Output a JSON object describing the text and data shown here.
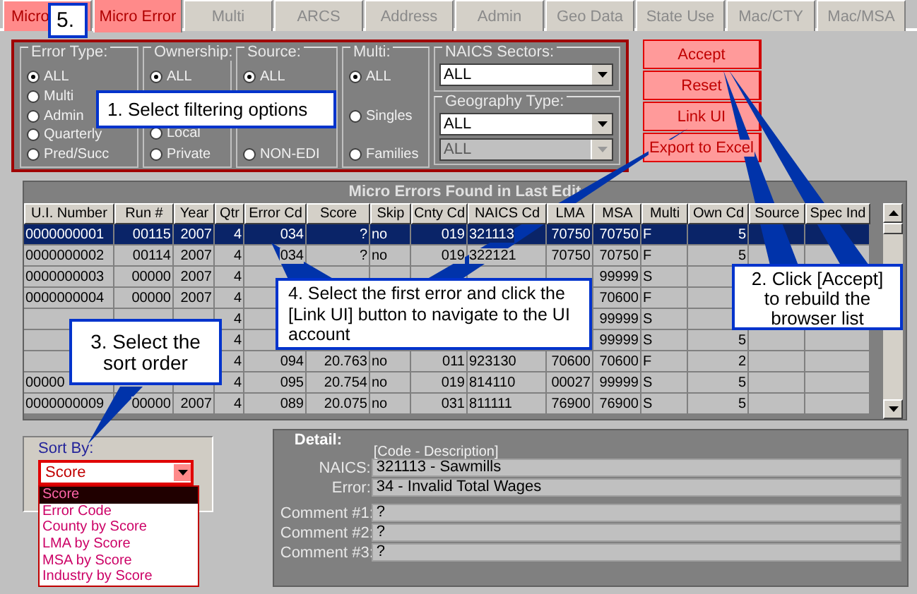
{
  "tabs": [
    {
      "label": "Micro",
      "selected": false,
      "disabled": false
    },
    {
      "label": "Micro Error",
      "selected": true,
      "disabled": false
    },
    {
      "label": "Multi",
      "selected": false,
      "disabled": true
    },
    {
      "label": "ARCS",
      "selected": false,
      "disabled": true
    },
    {
      "label": "Address",
      "selected": false,
      "disabled": true
    },
    {
      "label": "Admin",
      "selected": false,
      "disabled": true
    },
    {
      "label": "Geo Data",
      "selected": false,
      "disabled": true
    },
    {
      "label": "State Use",
      "selected": false,
      "disabled": true
    },
    {
      "label": "Mac/CTY",
      "selected": false,
      "disabled": true
    },
    {
      "label": "Mac/MSA",
      "selected": false,
      "disabled": true
    }
  ],
  "filters": {
    "groups": [
      {
        "title": "Error Type:",
        "options": [
          {
            "label": "ALL",
            "selected": true
          },
          {
            "label": "Multi",
            "selected": false
          },
          {
            "label": "Admin",
            "selected": false
          },
          {
            "label": "Quarterly",
            "selected": false
          },
          {
            "label": "Pred/Succ",
            "selected": false
          }
        ]
      },
      {
        "title": "Ownership:",
        "options": [
          {
            "label": "ALL",
            "selected": true
          },
          {
            "label": "Local",
            "selected": false
          },
          {
            "label": "Private",
            "selected": false
          }
        ]
      },
      {
        "title": "Source:",
        "options": [
          {
            "label": "ALL",
            "selected": true
          },
          {
            "label": "NON-EDI",
            "selected": false
          }
        ]
      },
      {
        "title": "Multi:",
        "options": [
          {
            "label": "ALL",
            "selected": true
          },
          {
            "label": "Singles",
            "selected": false
          },
          {
            "label": "Families",
            "selected": false
          }
        ]
      }
    ],
    "naics_sectors": {
      "label": "NAICS Sectors:",
      "value": "ALL",
      "disabled": false
    },
    "geography_type": {
      "label": "Geography Type:",
      "value": "ALL",
      "disabled": false
    },
    "geography_combo_2": {
      "value": "ALL",
      "disabled": true
    }
  },
  "buttons": [
    "Accept",
    "Reset",
    "Link UI",
    "Export to Excel"
  ],
  "table": {
    "title": "Micro Errors Found in Last Edit",
    "columns": [
      "U.I. Number",
      "Run #",
      "Year",
      "Qtr",
      "Error Cd",
      "Score",
      "Skip",
      "Cnty Cd",
      "NAICS Cd",
      "LMA",
      "MSA",
      "Multi",
      "Own Cd",
      "Source",
      "Spec Ind"
    ],
    "rows": [
      {
        "selected": true,
        "cells": [
          "0000000001",
          "00115",
          "2007",
          "4",
          "034",
          "?",
          "no",
          "019",
          "321113",
          "70750",
          "70750",
          "F",
          "5",
          null,
          null
        ]
      },
      {
        "selected": false,
        "cells": [
          "0000000002",
          "00114",
          "2007",
          "4",
          "034",
          "?",
          "no",
          "019",
          "322121",
          "70750",
          "70750",
          "F",
          "5",
          null,
          null
        ]
      },
      {
        "selected": false,
        "cells": [
          "0000000003",
          "00000",
          "2007",
          "4",
          null,
          null,
          null,
          null,
          null,
          null,
          "99999",
          "S",
          null,
          null,
          null
        ]
      },
      {
        "selected": false,
        "cells": [
          "0000000004",
          "00000",
          "2007",
          "4",
          null,
          null,
          null,
          null,
          null,
          null,
          "70600",
          "F",
          null,
          null,
          null
        ]
      },
      {
        "selected": false,
        "cells": [
          null,
          null,
          null,
          "4",
          null,
          null,
          null,
          null,
          null,
          null,
          "99999",
          "S",
          null,
          null,
          null
        ]
      },
      {
        "selected": false,
        "cells": [
          null,
          null,
          null,
          "4",
          null,
          null,
          null,
          null,
          null,
          null,
          "99999",
          "S",
          "5",
          null,
          null
        ]
      },
      {
        "selected": false,
        "cells": [
          null,
          null,
          null,
          "4",
          "094",
          "20.763",
          "no",
          "011",
          "923130",
          "70600",
          "70600",
          "F",
          "2",
          null,
          null
        ]
      },
      {
        "selected": false,
        "cells": [
          "00000",
          null,
          null,
          "4",
          "095",
          "20.754",
          "no",
          "019",
          "814110",
          "00027",
          "99999",
          "S",
          "5",
          null,
          null
        ]
      },
      {
        "selected": false,
        "cells": [
          "0000000009",
          "00000",
          "2007",
          "4",
          "089",
          "20.075",
          "no",
          "031",
          "811111",
          "76900",
          "76900",
          "S",
          "5",
          null,
          null
        ]
      }
    ]
  },
  "sort": {
    "label": "Sort By:",
    "value": "Score",
    "options": [
      {
        "label": "Score",
        "selected": true
      },
      {
        "label": "Error Code",
        "selected": false
      },
      {
        "label": "County by Score",
        "selected": false
      },
      {
        "label": "LMA by Score",
        "selected": false
      },
      {
        "label": "MSA by Score",
        "selected": false
      },
      {
        "label": "Industry by Score",
        "selected": false
      }
    ]
  },
  "detail": {
    "title": "Detail:",
    "header": "[Code - Description]",
    "fields": [
      {
        "label": "NAICS:",
        "value": "321113 - Sawmills"
      },
      {
        "label": "Error:",
        "value": "34 - Invalid Total Wages"
      },
      {
        "label": "Comment #1:",
        "value": "?"
      },
      {
        "label": "Comment #2:",
        "value": "?"
      },
      {
        "label": "Comment #3:",
        "value": "?"
      }
    ]
  },
  "callouts": [
    "5.",
    "1. Select filtering options",
    "4. Select the first error and click the [Link UI] button to navigate to the UI account",
    "3. Select the sort order",
    "2. Click [Accept] to rebuild the browser list"
  ]
}
